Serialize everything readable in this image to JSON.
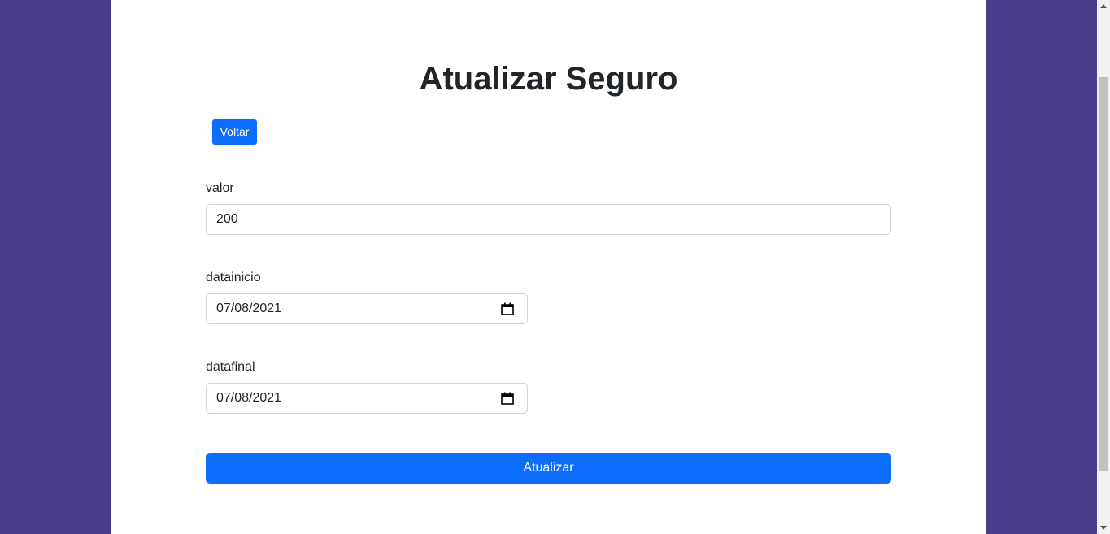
{
  "page": {
    "title": "Atualizar Seguro",
    "back_label": "Voltar",
    "submit_label": "Atualizar"
  },
  "form": {
    "valor": {
      "label": "valor",
      "value": "200"
    },
    "datainicio": {
      "label": "datainicio",
      "value": "07/08/2021"
    },
    "datafinal": {
      "label": "datafinal",
      "value": "07/08/2021"
    }
  },
  "icons": {
    "date_picker": "calendar-icon",
    "scroll_up": "chevron-up-icon",
    "scroll_down": "chevron-down-icon"
  },
  "colors": {
    "background": "#483d8b",
    "card": "#ffffff",
    "primary": "#0d6efd",
    "text": "#212529",
    "border": "#ced4da"
  }
}
